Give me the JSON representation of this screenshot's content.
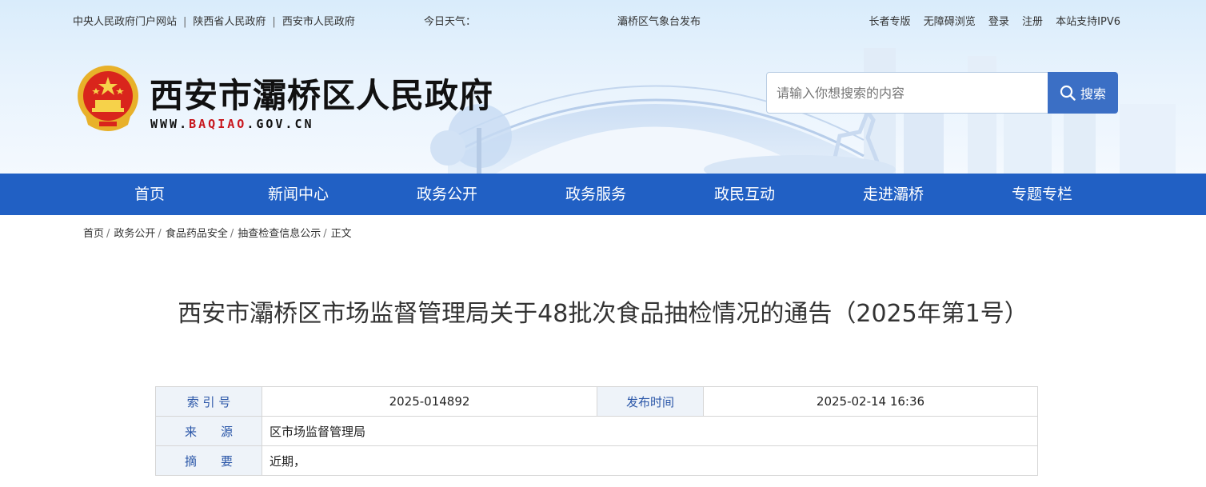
{
  "topbar": {
    "links": [
      "中央人民政府门户网站",
      "陕西省人民政府",
      "西安市人民政府"
    ],
    "separator": "|",
    "weather_label": "今日天气：",
    "weather_source": "灞桥区气象台发布",
    "right_links": [
      "长者专版",
      "无障碍浏览",
      "登录",
      "注册",
      "本站支持IPV6"
    ]
  },
  "site": {
    "title": "西安市灞桥区人民政府",
    "url_prefix": "WWW.",
    "url_highlight": "BAQIAO",
    "url_suffix": ".GOV.CN"
  },
  "search": {
    "placeholder": "请输入你想搜索的内容",
    "button_label": "搜索"
  },
  "nav": {
    "items": [
      "首页",
      "新闻中心",
      "政务公开",
      "政务服务",
      "政民互动",
      "走进灞桥",
      "专题专栏"
    ]
  },
  "breadcrumb": {
    "items": [
      "首页",
      "政务公开",
      "食品药品安全",
      "抽查检查信息公示",
      "正文"
    ],
    "separator": "/"
  },
  "article": {
    "title": "西安市灞桥区市场监督管理局关于48批次食品抽检情况的通告（2025年第1号）"
  },
  "meta": {
    "index_label": "索 引 号",
    "index_value": "2025-014892",
    "publish_label": "发布时间",
    "publish_value": "2025-02-14 16:36",
    "source_label": "来　　源",
    "source_value": "区市场监督管理局",
    "summary_label": "摘　　要",
    "summary_value": "近期，"
  },
  "colors": {
    "nav_bg": "#2160c4",
    "search_btn": "#3b6fc5",
    "url_highlight": "#c8161d",
    "label_text": "#2a56a8"
  }
}
